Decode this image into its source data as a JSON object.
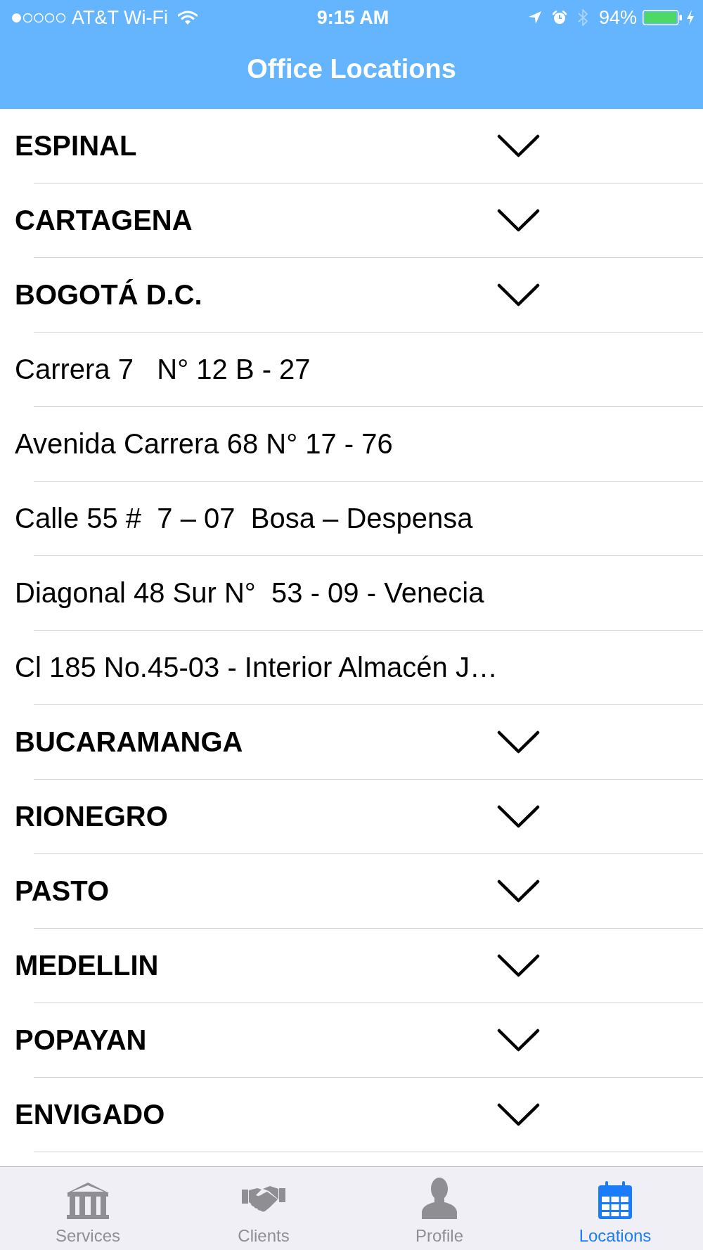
{
  "status_bar": {
    "carrier": "AT&T Wi-Fi",
    "time": "9:15 AM",
    "battery": "94%"
  },
  "nav_bar": {
    "title": "Office Locations"
  },
  "locations": [
    {
      "city": "ESPINAL"
    },
    {
      "city": "CARTAGENA"
    },
    {
      "city": "BOGOTÁ D.C.",
      "addresses": [
        "Carrera 7   N° 12 B - 27",
        "Avenida Carrera 68 N° 17 - 76",
        "Calle 55 #  7 – 07  Bosa – Despensa",
        "Diagonal 48 Sur N°  53 - 09 - Venecia",
        "Cl 185 No.45-03 - Interior Almacén J…"
      ]
    },
    {
      "city": "BUCARAMANGA"
    },
    {
      "city": "RIONEGRO"
    },
    {
      "city": "PASTO"
    },
    {
      "city": "MEDELLIN"
    },
    {
      "city": "POPAYAN"
    },
    {
      "city": "ENVIGADO"
    }
  ],
  "tab_bar": [
    {
      "label": "Services",
      "selected": false
    },
    {
      "label": "Clients",
      "selected": false
    },
    {
      "label": "Profile",
      "selected": false
    },
    {
      "label": "Locations",
      "selected": true
    }
  ]
}
